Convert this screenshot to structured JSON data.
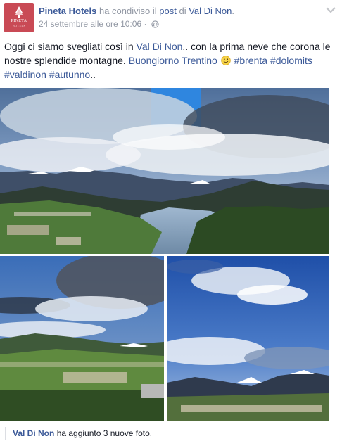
{
  "header": {
    "page_name": "Pineta Hotels",
    "action_text": "ha condiviso il",
    "post_link": "post",
    "of_text": "di",
    "source_page": "Val Di Non",
    "period": ".",
    "timestamp": "24 settembre alle ore 10:06",
    "separator": "·",
    "avatar_logo_name": "PINETA",
    "avatar_logo_sub": "HOTELS",
    "privacy_icon": "globe-icon",
    "menu_icon": "chevron-down-icon"
  },
  "post": {
    "text_before": "Oggi ci siamo svegliati così in ",
    "place_link": "Val Di Non",
    "text_after": ".. con la prima neve che corona le nostre splendide montagne. ",
    "greeting_link": "Buongiorno Trentino",
    "emoji": "smiley-emoji",
    "hashtags": [
      "#brenta",
      "#dolomits",
      "#valdinon",
      "#autunno"
    ],
    "ending": ".."
  },
  "photos": [
    {
      "subject": "lake and snowy mountains under clouds"
    },
    {
      "subject": "valley village under cloudy blue sky"
    },
    {
      "subject": "blue sky with clouds over mountain valley"
    }
  ],
  "footer": {
    "page": "Val Di Non",
    "text": "ha aggiunto 3 nuove foto."
  },
  "colors": {
    "link": "#3b5998",
    "text": "#141823",
    "muted": "#9197a3",
    "avatar_bg": "#c94a55"
  }
}
